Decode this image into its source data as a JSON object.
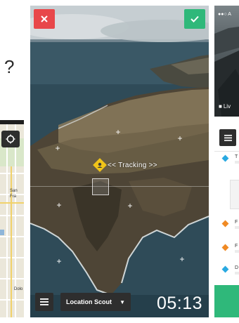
{
  "center": {
    "tracking_label": "<< Tracking >>",
    "mode_label": "Location Scout",
    "timer": "05:13",
    "icons": {
      "close": "close-icon",
      "confirm": "check-icon",
      "menu": "hamburger-menu-icon",
      "dropdown": "caret-down-icon",
      "target": "tracking-target-icon"
    },
    "colors": {
      "close": "#e8474a",
      "confirm": "#2fb87a",
      "target": "#f0c419",
      "button_bg": "#2e2e2e"
    }
  },
  "right": {
    "status_fragment": "A",
    "live_label": "Liv",
    "list_dot_colors": [
      "#29a9e1",
      "#f08a24",
      "#f08a24",
      "#29a9e1"
    ],
    "list_label_fragments": [
      "T",
      "F",
      "F",
      "D"
    ],
    "colors": {
      "accent": "#2fb87a"
    }
  },
  "left": {
    "glyph": "?",
    "map_labels": [
      "San",
      "Fra",
      "Dolo"
    ]
  }
}
